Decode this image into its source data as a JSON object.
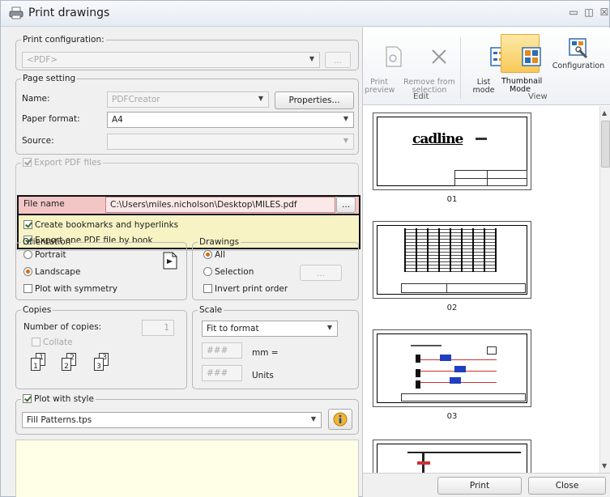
{
  "window": {
    "title": "Print drawings"
  },
  "print_config": {
    "legend": "Print configuration:",
    "value": "<PDF>",
    "browse_label": "..."
  },
  "page_setting": {
    "legend": "Page setting",
    "name_label": "Name:",
    "name_value": "PDFCreator",
    "properties_label": "Properties...",
    "paper_label": "Paper format:",
    "paper_value": "A4",
    "source_label": "Source:",
    "source_value": ""
  },
  "export": {
    "legend": "Export PDF files",
    "file_label": "File name",
    "file_value": "C:\\Users\\miles.nicholson\\Desktop\\MILES.pdf",
    "browse_label": "...",
    "bookmarks_label": "Create bookmarks and hyperlinks",
    "onefile_label": "Export one PDF file by book"
  },
  "orientation": {
    "legend": "Orientation",
    "portrait": "Portrait",
    "landscape": "Landscape",
    "symmetry": "Plot with symmetry"
  },
  "drawings": {
    "legend": "Drawings",
    "all": "All",
    "selection": "Selection",
    "browse_label": "...",
    "invert": "Invert print order"
  },
  "copies": {
    "legend": "Copies",
    "number_label": "Number of copies:",
    "number_value": "1",
    "collate": "Collate",
    "c1": "1",
    "c2": "2",
    "c3": "3"
  },
  "scale": {
    "legend": "Scale",
    "value": "Fit to format",
    "mm_placeholder": "###",
    "mm_label": "mm =",
    "units_placeholder": "###",
    "units_label": "Units"
  },
  "style": {
    "legend": "Plot with style",
    "value": "Fill Patterns.tps"
  },
  "ribbon": {
    "print_preview": "Print\npreview",
    "remove": "Remove from\nselection",
    "list_mode": "List\nmode",
    "thumbnail_mode": "Thumbnail\nMode",
    "configuration": "Configuration",
    "edit_group": "Edit",
    "view_group": "View"
  },
  "thumbnails": [
    {
      "label": "01",
      "logo": "cadline"
    },
    {
      "label": "02"
    },
    {
      "label": "03"
    },
    {
      "label": ""
    }
  ],
  "footer": {
    "print_label": "Print",
    "close_label": "Close"
  },
  "colors": {
    "accent_orange": "#d96a00",
    "highlight_red": "#f3c6c6",
    "highlight_yellow": "#f7f3c5",
    "ribbon_active": "#fbd77a"
  }
}
